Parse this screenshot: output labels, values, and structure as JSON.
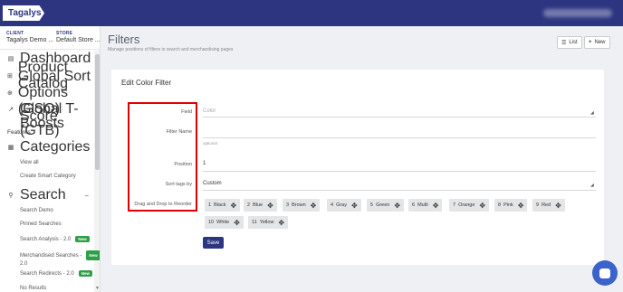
{
  "brand": {
    "logo_text": "Tagalys"
  },
  "context": {
    "client_label": "CLIENT",
    "client_value": "Tagalys Demo ...",
    "store_label": "STORE",
    "store_value": "Default Store ..."
  },
  "sidebar": {
    "top_items": [
      {
        "label": "Dashboard",
        "icon": "dashboard-icon"
      },
      {
        "label": "Product Catalog",
        "icon": "grid-icon"
      },
      {
        "label": "Global Sort Options (GSO)",
        "icon": "globe-icon"
      },
      {
        "label": "Global T-Score Boosts (GTB)",
        "icon": "trend-icon"
      }
    ],
    "features_label": "Features",
    "categories": {
      "label": "Categories",
      "collapse": "−",
      "items": [
        "View all",
        "Create Smart Category"
      ]
    },
    "search": {
      "label": "Search",
      "collapse": "−",
      "items": [
        {
          "label": "Search Demo",
          "badge": ""
        },
        {
          "label": "Pinned Searches",
          "badge": ""
        },
        {
          "label": "Search Analysis - 2.0",
          "badge": "New"
        },
        {
          "label": "Merchandised Searches -",
          "label2": "2.0",
          "badge": "New"
        },
        {
          "label": "Search Redirects - 2.0",
          "badge": "New"
        },
        {
          "label": "No Results",
          "badge": ""
        }
      ]
    }
  },
  "header": {
    "title": "Filters",
    "subtitle": "Manage positions of filters in search and merchandising pages",
    "list_button": "List",
    "new_button": "New"
  },
  "form": {
    "title": "Edit Color Filter",
    "fields": {
      "field_label": "Field",
      "field_value": "Color",
      "filter_name_label": "Filter Name",
      "filter_name_value": "",
      "filter_name_hint": "optional",
      "position_label": "Position",
      "position_value": "1",
      "sort_tags_label": "Sort tags by",
      "sort_tags_value": "Custom",
      "drag_label": "Drag and Drop to Reorder"
    },
    "tags": [
      {
        "num": "1",
        "name": "Black"
      },
      {
        "num": "2",
        "name": "Blue"
      },
      {
        "num": "3",
        "name": "Brown"
      },
      {
        "num": "4",
        "name": "Gray"
      },
      {
        "num": "5",
        "name": "Green"
      },
      {
        "num": "6",
        "name": "Multi"
      },
      {
        "num": "7",
        "name": "Orange"
      },
      {
        "num": "8",
        "name": "Pink"
      },
      {
        "num": "9",
        "name": "Red"
      },
      {
        "num": "10",
        "name": "White"
      },
      {
        "num": "11",
        "name": "Yellow"
      }
    ],
    "save_label": "Save"
  },
  "colors": {
    "primary": "#2d3580",
    "highlight": "#e00000",
    "badge": "#2e9e48",
    "chat": "#3a63cc"
  }
}
